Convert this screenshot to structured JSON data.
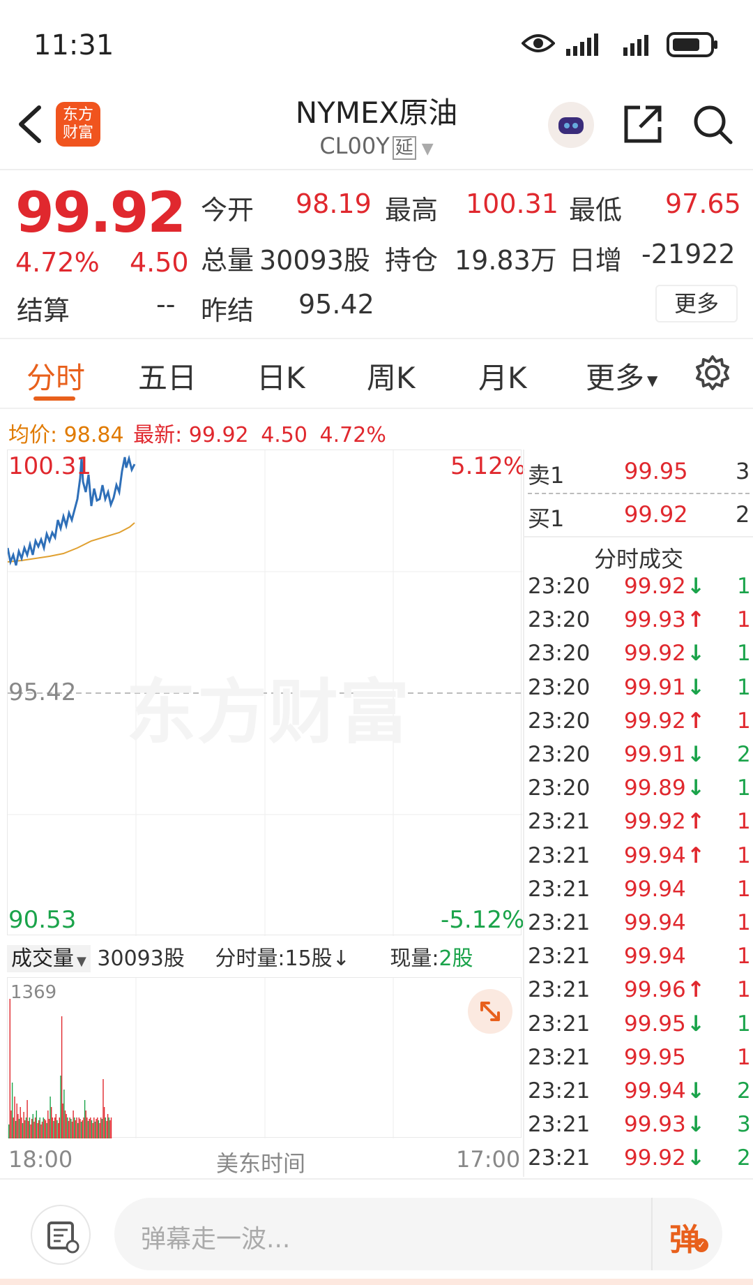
{
  "status_bar": {
    "time": "11:31"
  },
  "header": {
    "logo_text": "东方财富",
    "title": "NYMEX原油",
    "subtitle": "CL00Y",
    "delay_badge": "延"
  },
  "quote": {
    "last": "99.92",
    "change_pct": "4.72%",
    "change": "4.50",
    "settle_label": "结算",
    "settle_value": "--",
    "open_label": "今开",
    "open_value": "98.19",
    "high_label": "最高",
    "high_value": "100.31",
    "low_label": "最低",
    "low_value": "97.65",
    "volume_label": "总量",
    "volume_value": "30093股",
    "oi_label": "持仓",
    "oi_value": "19.83万",
    "daily_inc_label": "日增",
    "daily_inc_value": "-21922",
    "prev_settle_label": "昨结",
    "prev_settle_value": "95.42",
    "more_button": "更多"
  },
  "tabs": [
    "分时",
    "五日",
    "日K",
    "周K",
    "月K",
    "更多"
  ],
  "info_line": {
    "avg_label": "均价:",
    "avg_value": "98.84",
    "latest_label": "最新:",
    "latest_value": "99.92",
    "latest_change": "4.50",
    "latest_pct": "4.72%"
  },
  "chart_labels": {
    "top_price": "100.31",
    "top_pct": "5.12%",
    "mid_price": "95.42",
    "bottom_price": "90.53",
    "bottom_pct": "-5.12%",
    "watermark": "东方财富",
    "volume_max": "1369",
    "time_start": "18:00",
    "time_mid": "美东时间",
    "time_end": "17:00"
  },
  "volume_bar": {
    "selector": "成交量",
    "total": "30093股",
    "minute_vol_label": "分时量:",
    "minute_vol_value": "15股↓",
    "current_label": "现量:",
    "current_value": "2股"
  },
  "order_book": {
    "ask": {
      "label": "卖1",
      "price": "99.95",
      "qty": "3"
    },
    "bid": {
      "label": "买1",
      "price": "99.92",
      "qty": "2"
    },
    "ticks_title": "分时成交"
  },
  "ticks": [
    {
      "time": "23:20",
      "price": "99.92",
      "dir": "↓",
      "qty": "1"
    },
    {
      "time": "23:20",
      "price": "99.93",
      "dir": "↑",
      "qty": "1"
    },
    {
      "time": "23:20",
      "price": "99.92",
      "dir": "↓",
      "qty": "1"
    },
    {
      "time": "23:20",
      "price": "99.91",
      "dir": "↓",
      "qty": "1"
    },
    {
      "time": "23:20",
      "price": "99.92",
      "dir": "↑",
      "qty": "1"
    },
    {
      "time": "23:20",
      "price": "99.91",
      "dir": "↓",
      "qty": "2"
    },
    {
      "time": "23:20",
      "price": "99.89",
      "dir": "↓",
      "qty": "1"
    },
    {
      "time": "23:21",
      "price": "99.92",
      "dir": "↑",
      "qty": "1"
    },
    {
      "time": "23:21",
      "price": "99.94",
      "dir": "↑",
      "qty": "1"
    },
    {
      "time": "23:21",
      "price": "99.94",
      "dir": "",
      "qty": "1"
    },
    {
      "time": "23:21",
      "price": "99.94",
      "dir": "",
      "qty": "1"
    },
    {
      "time": "23:21",
      "price": "99.94",
      "dir": "",
      "qty": "1"
    },
    {
      "time": "23:21",
      "price": "99.96",
      "dir": "↑",
      "qty": "1"
    },
    {
      "time": "23:21",
      "price": "99.95",
      "dir": "↓",
      "qty": "1"
    },
    {
      "time": "23:21",
      "price": "99.95",
      "dir": "",
      "qty": "1"
    },
    {
      "time": "23:21",
      "price": "99.94",
      "dir": "↓",
      "qty": "2"
    },
    {
      "time": "23:21",
      "price": "99.93",
      "dir": "↓",
      "qty": "3"
    },
    {
      "time": "23:21",
      "price": "99.92",
      "dir": "↓",
      "qty": "2"
    }
  ],
  "comment_bar": {
    "placeholder": "弹幕走一波...",
    "send_label": "弹"
  },
  "colors": {
    "up": "#e0282e",
    "down": "#1aa34a",
    "accent": "#e8601c",
    "price_line": "#2e6fb8",
    "avg_line": "#e0a030"
  }
}
